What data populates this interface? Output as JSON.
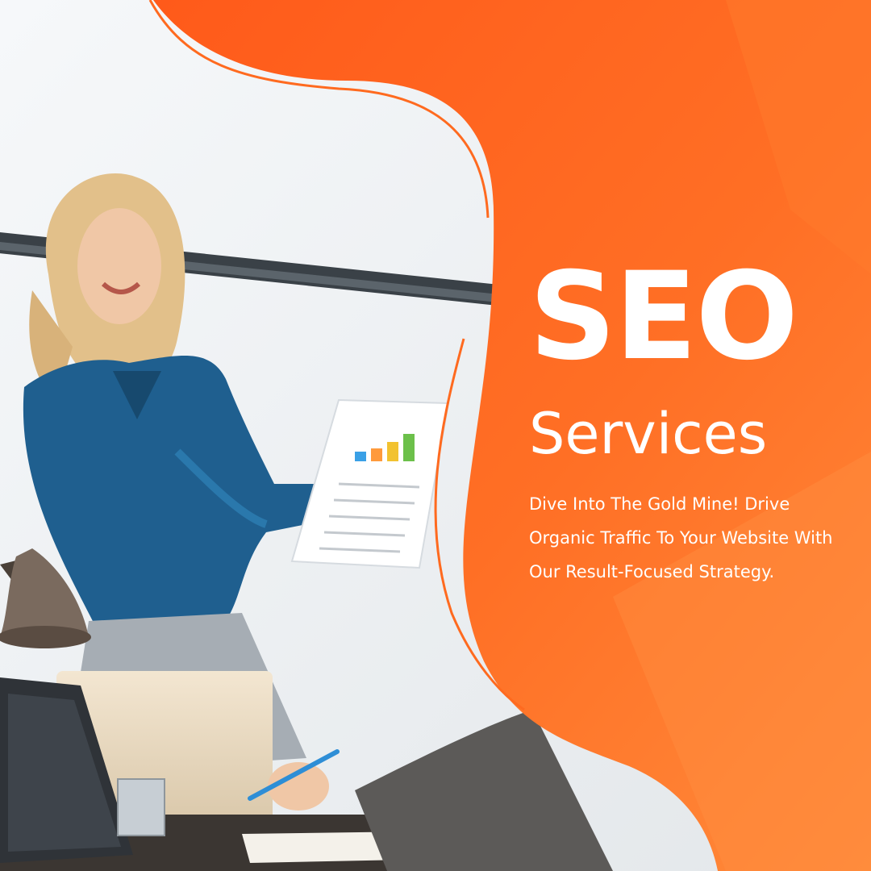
{
  "poster": {
    "title": "SEO",
    "subtitle": "Services",
    "tagline": "Dive Into The Gold Mine! Drive Organic Traffic To Your Website With Our Result-Focused Strategy."
  },
  "theme": {
    "accent": "#ff6a1f",
    "accent_dark": "#f45a17",
    "accent_light": "#ff8a3a",
    "text": "#ffffff"
  },
  "photo_subjects": [
    "woman-presenting-icon",
    "chart-paper-icon",
    "laptop-icon",
    "desk-lamp-icon"
  ]
}
